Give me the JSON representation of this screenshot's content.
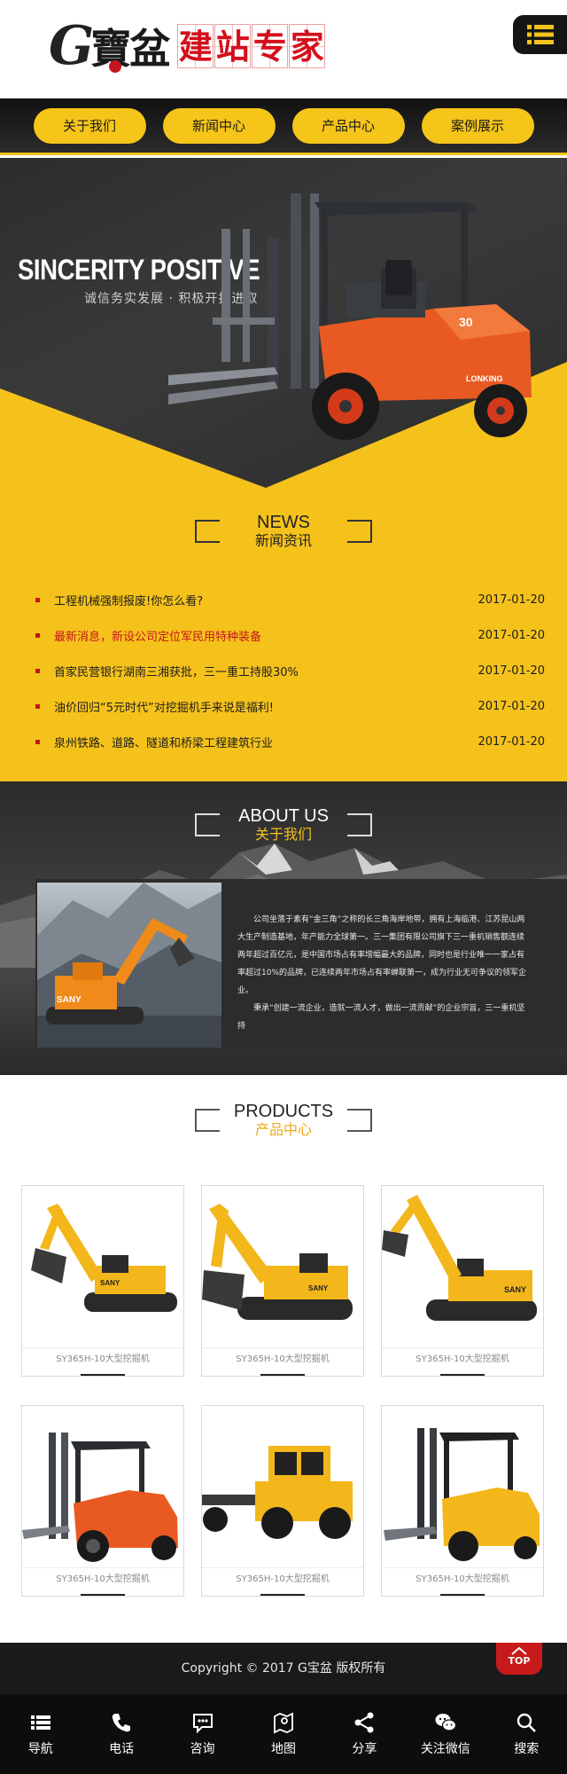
{
  "header": {
    "logo_letter": "G",
    "logo_cn": "寶盆",
    "tagline_chars": [
      "建",
      "站",
      "专",
      "家"
    ],
    "menu_icon": "menu-icon"
  },
  "nav": {
    "items": [
      {
        "label": "关于我们"
      },
      {
        "label": "新闻中心"
      },
      {
        "label": "产品中心"
      },
      {
        "label": "案例展示"
      }
    ]
  },
  "banner": {
    "title": "SINCERITY POSITIVE",
    "subtitle": "诚信务实发展 · 积极开拓进取",
    "forklift_brand": "LONKING",
    "forklift_model": "30"
  },
  "news": {
    "title_en": "NEWS",
    "title_cn": "新闻资讯",
    "items": [
      {
        "title": " 工程机械强制报废!你怎么看?",
        "date": "2017-01-20",
        "highlight": false
      },
      {
        "title": "最新消息，新设公司定位军民用特种装备",
        "date": "2017-01-20",
        "highlight": true
      },
      {
        "title": "首家民营银行湖南三湘获批，三一重工持股30%",
        "date": "2017-01-20",
        "highlight": false
      },
      {
        "title": " 油价回归“5元时代”对挖掘机手来说是福利!",
        "date": "2017-01-20",
        "highlight": false
      },
      {
        "title": "泉州铁路、道路、隧道和桥梁工程建筑行业",
        "date": "2017-01-20",
        "highlight": false
      }
    ]
  },
  "about": {
    "title_en": "ABOUT US",
    "title_cn": "关于我们",
    "paragraph1": "公司坐落于素有“金三角”之称的长三角海岸地带，拥有上海临港、江苏昆山两大生产制造基地，年产能力全球第一。三一集团有限公司旗下三一重机销售额连续两年超过百亿元，是中国市场占有率增幅最大的品牌，同时也是行业唯一一家占有率超过10%的品牌，已连续两年市场占有率蝉联第一，成为行业无可争议的领军企业。",
    "paragraph2": "秉承“创建一流企业，造就一流人才，做出一流贡献”的企业宗旨，三一重机坚持",
    "machine_brand": "SANY"
  },
  "products": {
    "title_en": "PRODUCTS",
    "title_cn": "产品中心",
    "items": [
      {
        "name": "SY365H-10大型挖掘机",
        "kind": "excavator"
      },
      {
        "name": "SY365H-10大型挖掘机",
        "kind": "excavator"
      },
      {
        "name": "SY365H-10大型挖掘机",
        "kind": "excavator"
      },
      {
        "name": "SY365H-10大型挖掘机",
        "kind": "forklift"
      },
      {
        "name": "SY365H-10大型挖掘机",
        "kind": "tractor"
      },
      {
        "name": "SY365H-10大型挖掘机",
        "kind": "forklift"
      }
    ]
  },
  "footer": {
    "copyright": "Copyright © 2017 G宝盆 版权所有",
    "top_label": "TOP"
  },
  "bottom_nav": {
    "items": [
      {
        "label": "导航",
        "icon": "list-icon"
      },
      {
        "label": "电话",
        "icon": "phone-icon"
      },
      {
        "label": "咨询",
        "icon": "chat-icon"
      },
      {
        "label": "地图",
        "icon": "map-icon"
      },
      {
        "label": "分享",
        "icon": "share-icon"
      },
      {
        "label": "关注微信",
        "icon": "wechat-icon"
      },
      {
        "label": "搜索",
        "icon": "search-icon"
      }
    ]
  },
  "colors": {
    "accent_yellow": "#f5c21b",
    "dark": "#1a1a1a",
    "red": "#c4161c"
  }
}
